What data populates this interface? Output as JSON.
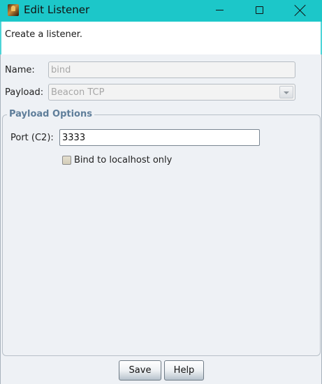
{
  "window": {
    "title": "Edit Listener"
  },
  "header": {
    "text": "Create a listener."
  },
  "form": {
    "name_label": "Name:",
    "name_value": "bind",
    "payload_label": "Payload:",
    "payload_value": "Beacon TCP"
  },
  "payload_options": {
    "legend": "Payload Options",
    "port_label": "Port (C2):",
    "port_value": "3333",
    "bind_label": "Bind to localhost only",
    "bind_checked": false
  },
  "buttons": {
    "save": "Save",
    "help": "Help"
  },
  "colors": {
    "titlebar": "#1cc7c9",
    "content_bg": "#eef1f5",
    "legend": "#5f7e9a"
  }
}
